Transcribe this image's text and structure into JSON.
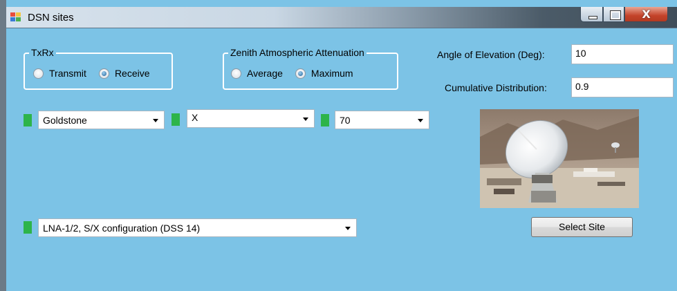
{
  "window": {
    "title": "DSN sites",
    "controls": {
      "close_glyph": "X"
    }
  },
  "txrx": {
    "legend": "TxRx",
    "options": [
      {
        "label": "Transmit",
        "checked": false
      },
      {
        "label": "Receive",
        "checked": true
      }
    ]
  },
  "zenith": {
    "legend": "Zenith Atmospheric Attenuation",
    "options": [
      {
        "label": "Average",
        "checked": false
      },
      {
        "label": "Maximum",
        "checked": true
      }
    ]
  },
  "elevation": {
    "label": "Angle of Elevation (Deg):",
    "value": "10"
  },
  "cumulative": {
    "label": "Cumulative Distribution:",
    "value": "0.9"
  },
  "combos": {
    "site": "Goldstone",
    "band": "X",
    "antenna": "70",
    "configuration": "LNA-1/2, S/X configuration (DSS 14)"
  },
  "indicator_color": "#2db44a",
  "select_site_label": "Select Site"
}
